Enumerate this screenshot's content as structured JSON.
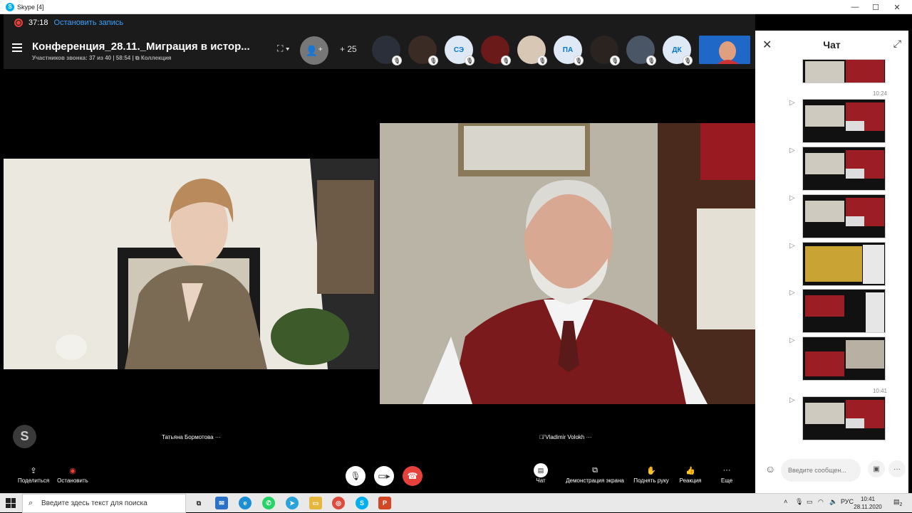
{
  "window": {
    "title": "Skype [4]",
    "controls": [
      "—",
      "☐",
      "✕"
    ]
  },
  "recording": {
    "time": "37:18",
    "stop_label": "Остановить запись"
  },
  "header": {
    "conference_title": "Конференция_28.11._Миграция в истор...",
    "subtitle": "Участников звонка: 37 из 40 | 58:54 | ⧉ Коллекция",
    "extra_participants": "+ 25",
    "participants": [
      {
        "label": "",
        "color": "#2a2f3a"
      },
      {
        "label": "",
        "color": "#3a2b24"
      },
      {
        "label": "СЭ",
        "color": "#dfe9f6"
      },
      {
        "label": "",
        "color": "#6b1a1a"
      },
      {
        "label": "",
        "color": "#d9c7b5"
      },
      {
        "label": "ПА",
        "color": "#dfe9f6"
      },
      {
        "label": "",
        "color": "#2b2320"
      },
      {
        "label": "",
        "color": "#4a5566"
      },
      {
        "label": "ДК",
        "color": "#dfe9f6"
      }
    ]
  },
  "videos": {
    "left_name": "Татьяна Бормотова ···",
    "right_name": "🎙̸ Vladimir Volokh ···"
  },
  "toolbar": {
    "share": "Поделиться",
    "stop": "Остановить",
    "chat": "Чат",
    "screen_share": "Демонстрация экрана",
    "raise_hand": "Поднять руку",
    "reaction": "Реакция",
    "more": "Еще"
  },
  "chat": {
    "title": "Чат",
    "times": [
      "10:24",
      "10:41"
    ],
    "input_placeholder": "Введите сообщен..."
  },
  "taskbar": {
    "search_placeholder": "Введите здесь текст для поиска",
    "language": "РУС",
    "time": "10:41",
    "date": "28.11.2020",
    "notification_count": "2"
  }
}
